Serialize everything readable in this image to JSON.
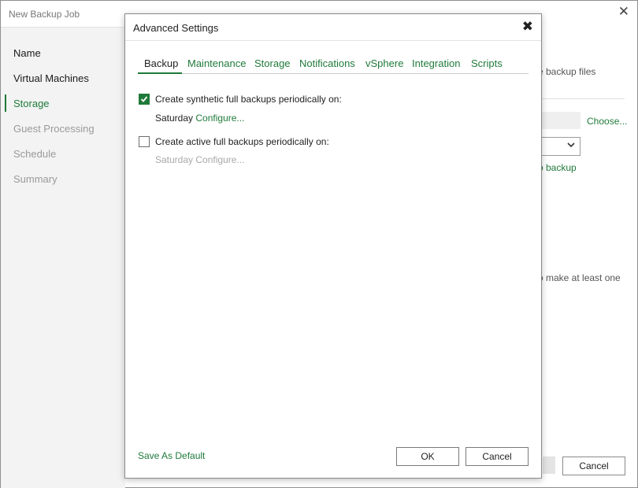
{
  "window": {
    "title": "New Backup Job",
    "close_glyph": "✕"
  },
  "sidebar": {
    "items": [
      {
        "label": "Name",
        "state": "done"
      },
      {
        "label": "Virtual Machines",
        "state": "done"
      },
      {
        "label": "Storage",
        "state": "active"
      },
      {
        "label": "Guest Processing",
        "state": "pending"
      },
      {
        "label": "Schedule",
        "state": "pending"
      },
      {
        "label": "Summary",
        "state": "pending"
      }
    ]
  },
  "background": {
    "backup_files_text": "e backup files",
    "choose_link": "Choose...",
    "backup_link": "p backup",
    "hint_text": "o make at least one",
    "cancel_label": "Cancel"
  },
  "dialog": {
    "title": "Advanced Settings",
    "close_glyph": "✖",
    "tabs": [
      {
        "label": "Backup",
        "active": true
      },
      {
        "label": "Maintenance"
      },
      {
        "label": "Storage"
      },
      {
        "label": "Notifications"
      },
      {
        "label": "vSphere"
      },
      {
        "label": "Integration"
      },
      {
        "label": "Scripts"
      }
    ],
    "synthetic": {
      "checked": true,
      "label": "Create synthetic full backups periodically on:",
      "day": "Saturday",
      "configure": "Configure..."
    },
    "active_full": {
      "checked": false,
      "label": "Create active full backups periodically on:",
      "day": "Saturday",
      "configure": "Configure..."
    },
    "save_default": "Save As Default",
    "ok_label": "OK",
    "cancel_label": "Cancel"
  },
  "colors": {
    "accent": "#1f7a3a",
    "sidebar_bg": "#f3f3f3",
    "disabled_text": "#a8a8a8"
  }
}
